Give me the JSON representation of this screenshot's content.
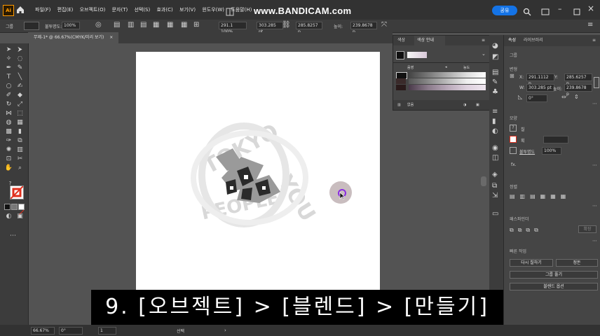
{
  "app": {
    "logo": "Ai",
    "watermark": "www.BANDICAM.com"
  },
  "menu": [
    "파일(F)",
    "편집(E)",
    "오브젝트(O)",
    "문자(T)",
    "선택(S)",
    "효과(C)",
    "보기(V)",
    "윈도우(W)",
    "도움말(H)"
  ],
  "share_label": "공유",
  "control_bar": {
    "group_label": "그룹",
    "opacity_label": "불투명도:",
    "opacity_value": "100%",
    "x_value": "291.1 100%",
    "w_value": "303.285 pt",
    "h_value": "285.8257 p",
    "height_label": "높이:",
    "height_value": "239.8678 p"
  },
  "document_tab": {
    "title": "무제-1* @ 66.67%(CMYK/미리 보기)",
    "close": "×"
  },
  "swatch_panel": {
    "tabs": [
      "색상",
      "색상 안내"
    ],
    "row_left": "음영",
    "row_right": "농도",
    "footer_label": "없음"
  },
  "right_panel": {
    "tabs": [
      "속성",
      "라이브러리"
    ],
    "selection_type": "그룹",
    "transform_title": "변형",
    "x_label": "X:",
    "x_value": "291.1112 p",
    "y_label": "Y:",
    "y_value": "285.6257 p",
    "w_label": "W:",
    "w_value": "303.285 pt",
    "h_label": "높이:",
    "h_value": "239.8678 p",
    "rotate_value": "0°",
    "appearance_title": "모양",
    "fill_label": "칠",
    "stroke_label": "획",
    "opacity_label": "불투명도",
    "opacity_value": "100%",
    "fx_label": "fx.",
    "align_title": "정렬",
    "pathfinder_title": "패스파인더",
    "expand_label": "확장",
    "quick_actions_title": "빠른 작업",
    "btn_recolor": "다시 칠하기",
    "btn_arrange": "정돈",
    "btn_ungroup": "그룹 풀기",
    "btn_blend_options": "블렌드 옵션"
  },
  "subtitle": "9. [오브젝트] > [블렌드] > [만들기]",
  "status": {
    "zoom": "66.67%",
    "angle": "0°",
    "page": "1",
    "mode": "선택"
  },
  "artwork_text": [
    "TOKYO",
    "PEOPLE",
    "YOU"
  ],
  "colors": {
    "accent": "#1473e6",
    "ai_orange": "#ff9a00",
    "cursor_ring": "#8a2be2"
  }
}
